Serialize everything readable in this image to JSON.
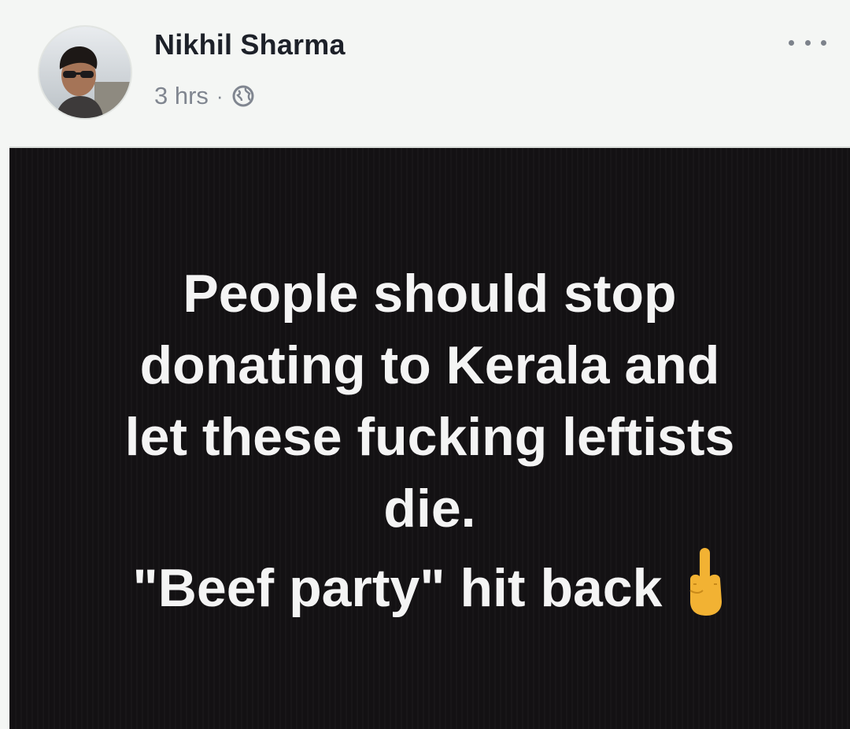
{
  "post": {
    "author": "Nikhil Sharma",
    "timestamp": "3 hrs",
    "separator": "·",
    "audience_icon": "globe-icon",
    "more_icon": "more-options-icon",
    "lines": [
      "People should stop",
      "donating to Kerala and",
      "let these fucking leftists",
      "die.",
      "\"Beef party\" hit back"
    ],
    "emoji": "middle-finger-icon"
  },
  "colors": {
    "header_bg": "#f4f6f4",
    "card_bg": "#131113",
    "text": "#f4f4f4",
    "author": "#1d2129",
    "meta": "#808690"
  }
}
